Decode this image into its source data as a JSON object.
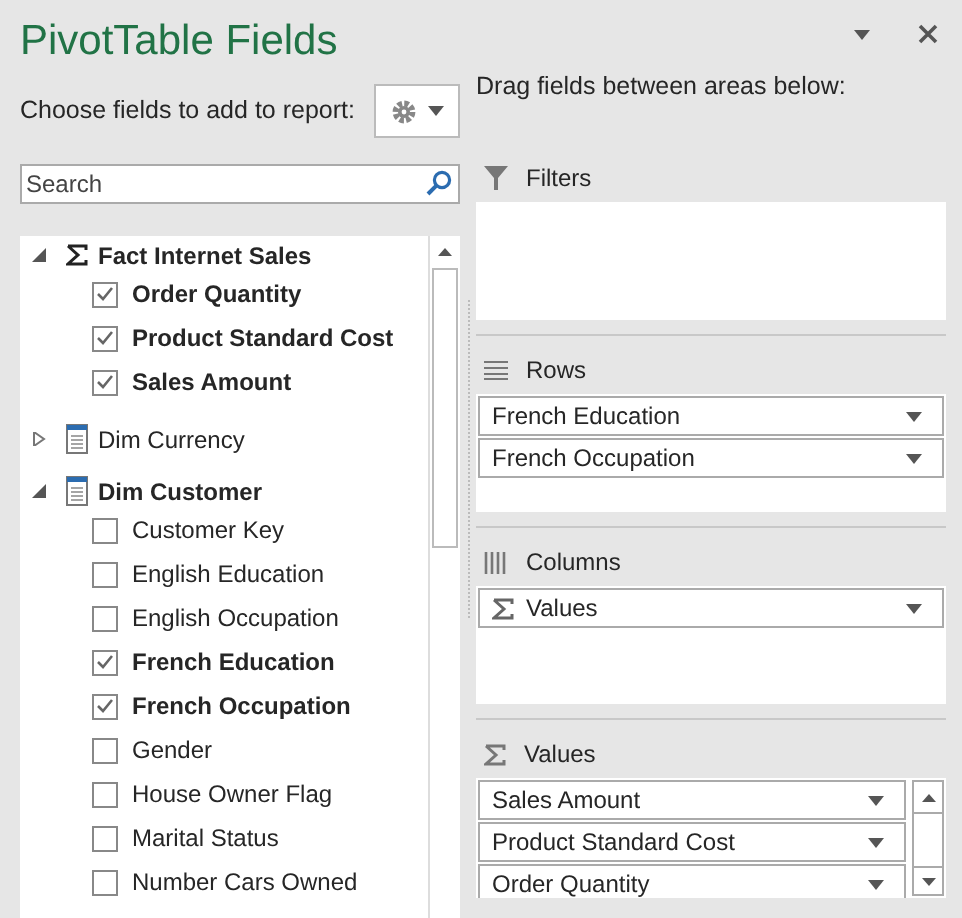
{
  "title": "PivotTable Fields",
  "choose_label": "Choose fields to add to report:",
  "search": {
    "placeholder": "Search"
  },
  "tables": [
    {
      "name": "Fact Internet Sales",
      "kind": "measure",
      "expanded": true,
      "fields": [
        {
          "name": "Order Quantity",
          "checked": true
        },
        {
          "name": "Product Standard Cost",
          "checked": true
        },
        {
          "name": "Sales Amount",
          "checked": true
        }
      ]
    },
    {
      "name": "Dim Currency",
      "kind": "dimension",
      "expanded": false
    },
    {
      "name": "Dim Customer",
      "kind": "dimension",
      "expanded": true,
      "fields": [
        {
          "name": "Customer Key",
          "checked": false
        },
        {
          "name": "English Education",
          "checked": false
        },
        {
          "name": "English Occupation",
          "checked": false
        },
        {
          "name": "French Education",
          "checked": true
        },
        {
          "name": "French Occupation",
          "checked": true
        },
        {
          "name": "Gender",
          "checked": false
        },
        {
          "name": "House Owner Flag",
          "checked": false
        },
        {
          "name": "Marital Status",
          "checked": false
        },
        {
          "name": "Number Cars Owned",
          "checked": false
        }
      ]
    }
  ],
  "drag_label": "Drag fields between areas below:",
  "areas": [
    {
      "kind": "filters",
      "label": "Filters"
    },
    {
      "kind": "rows",
      "label": "Rows",
      "items": [
        {
          "name": "French Education"
        },
        {
          "name": "French Occupation"
        }
      ]
    },
    {
      "kind": "columns",
      "label": "Columns",
      "items": [
        {
          "name": "Values",
          "sigma": true
        }
      ]
    },
    {
      "kind": "values",
      "label": "Values",
      "items": [
        {
          "name": "Sales Amount"
        },
        {
          "name": "Product Standard Cost"
        },
        {
          "name": "Order Quantity"
        }
      ]
    }
  ]
}
